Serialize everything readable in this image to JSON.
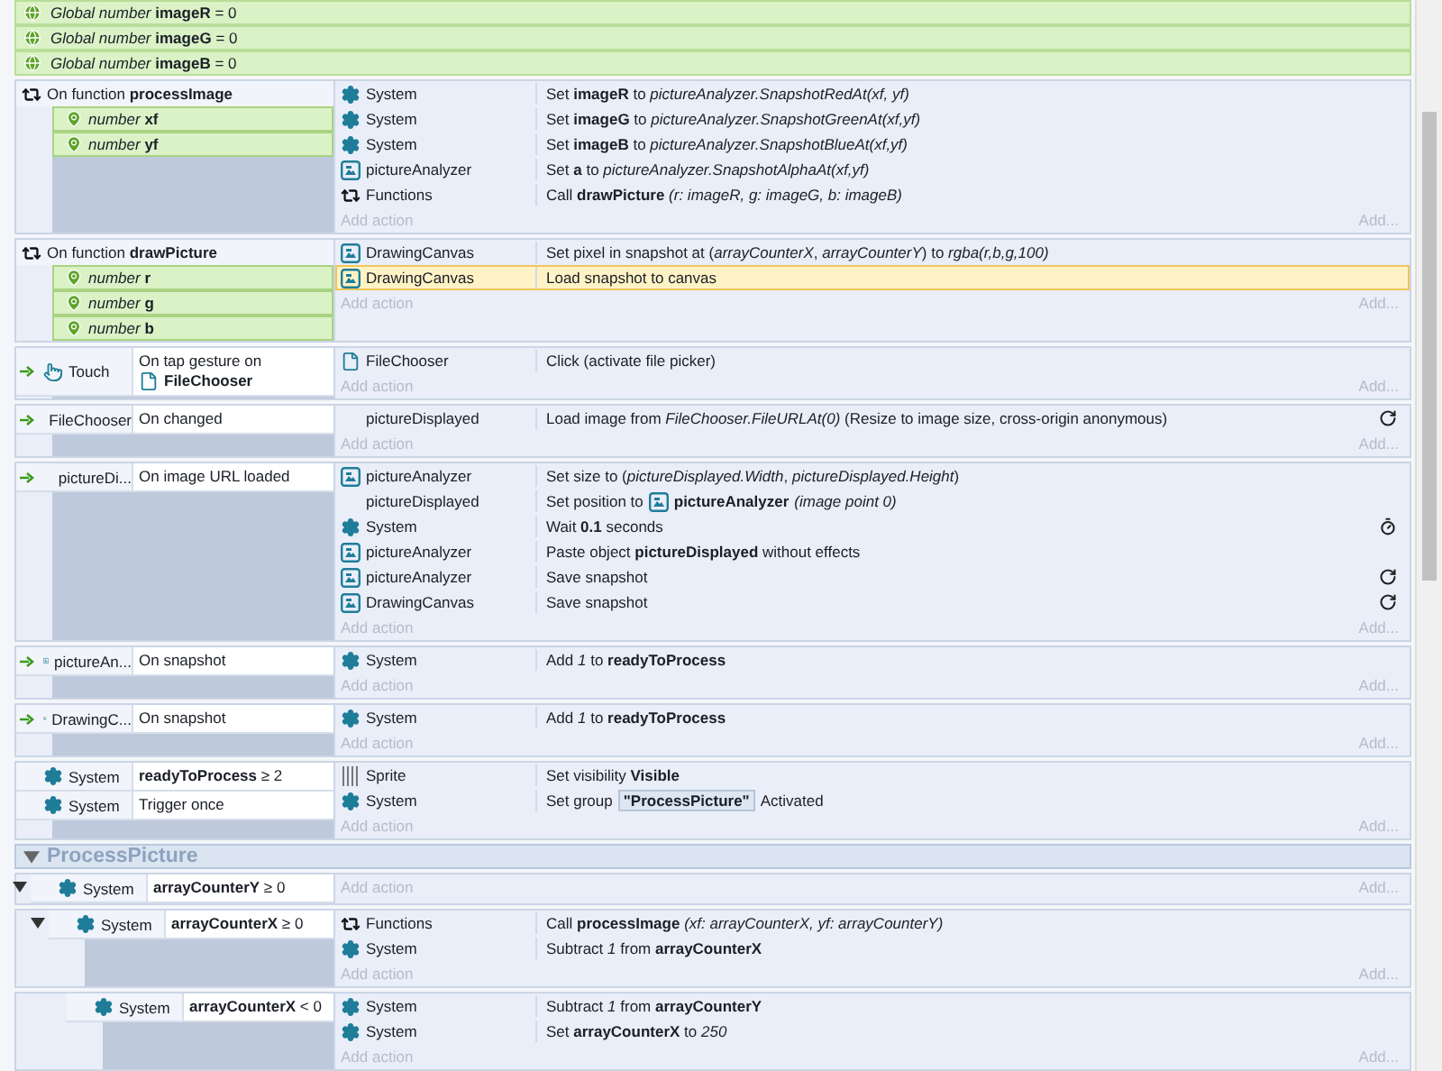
{
  "globals": [
    {
      "text": "*Global number* **imageR** = 0"
    },
    {
      "text": "*Global number* **imageG** = 0"
    },
    {
      "text": "*Global number* **imageB** = 0"
    }
  ],
  "events": [
    {
      "kind": "event",
      "trigger": false,
      "conditions": [
        {
          "kind": "function",
          "text": "On function **processImage**"
        }
      ],
      "params": [
        "*number* **xf**",
        "*number* **yf**"
      ],
      "actions": [
        {
          "kind": "system",
          "object": "System",
          "text": "Set **imageR** to *pictureAnalyzer.SnapshotRedAt(xf, yf)*",
          "selected": false
        },
        {
          "kind": "system",
          "object": "System",
          "text": "Set **imageG** to *pictureAnalyzer.SnapshotGreenAt(xf,yf)*",
          "selected": false
        },
        {
          "kind": "system",
          "object": "System",
          "text": "Set **imageB** to *pictureAnalyzer.SnapshotBlueAt(xf,yf)*",
          "selected": false
        },
        {
          "kind": "canvas",
          "object": "pictureAnalyzer",
          "text": "Set **a** to *pictureAnalyzer.SnapshotAlphaAt(xf,yf)*",
          "selected": false
        },
        {
          "kind": "functions",
          "object": "Functions",
          "text": "Call **drawPicture** *(r: imageR, g: imageG, b: imageB)*",
          "selected": false
        }
      ],
      "add_action": "Add action",
      "add_more": "Add..."
    },
    {
      "kind": "event",
      "trigger": false,
      "conditions": [
        {
          "kind": "function",
          "text": "On function **drawPicture**"
        }
      ],
      "params": [
        "*number* **r**",
        "*number* **g**",
        "*number* **b**"
      ],
      "actions": [
        {
          "kind": "canvas",
          "object": "DrawingCanvas",
          "text": "Set pixel in snapshot at (*arrayCounterX*, *arrayCounterY*) to *rgba(r,b,g,100)*",
          "selected": false
        },
        {
          "kind": "canvas",
          "object": "DrawingCanvas",
          "text": "Load snapshot to canvas",
          "selected": true
        }
      ],
      "add_action": "Add action",
      "add_more": "Add..."
    },
    {
      "kind": "event",
      "trigger": true,
      "conditions": [
        {
          "kind": "touch",
          "object": "Touch",
          "text": "On tap gesture on",
          "ref": {
            "kind": "file",
            "text": "FileChooser"
          }
        }
      ],
      "actions": [
        {
          "kind": "file",
          "object": "FileChooser",
          "text": "Click (activate file picker)",
          "selected": false
        }
      ],
      "add_action": "Add action",
      "add_more": "Add..."
    },
    {
      "kind": "event",
      "trigger": true,
      "conditions": [
        {
          "kind": "file",
          "object": "FileChooser",
          "text": "On changed"
        }
      ],
      "actions": [
        {
          "kind": "plain",
          "object": "pictureDisplayed",
          "text": "Load image from *FileChooser.FileURLAt(0)* (Resize to image size, cross-origin anonymous)",
          "end_icon": {
            "kind": "async"
          },
          "selected": false
        }
      ],
      "add_action": "Add action",
      "add_more": "Add..."
    },
    {
      "kind": "event",
      "trigger": true,
      "conditions": [
        {
          "kind": "plain",
          "object": "pictureDi...",
          "text": "On image URL loaded"
        }
      ],
      "actions": [
        {
          "kind": "canvas",
          "object": "pictureAnalyzer",
          "text": "Set size to (*pictureDisplayed.Width*, *pictureDisplayed.Height*)",
          "selected": false
        },
        {
          "kind": "plain",
          "object": "pictureDisplayed",
          "text": "Set position to",
          "ref": {
            "kind": "canvas",
            "text": "pictureAnalyzer"
          },
          "tail": "*(image point 0)*",
          "selected": false
        },
        {
          "kind": "system",
          "object": "System",
          "text": "Wait **0.1** seconds",
          "end_icon": {
            "kind": "wait"
          },
          "selected": false
        },
        {
          "kind": "canvas",
          "object": "pictureAnalyzer",
          "text": "Paste object **pictureDisplayed** without effects",
          "selected": false
        },
        {
          "kind": "canvas",
          "object": "pictureAnalyzer",
          "text": "Save snapshot",
          "end_icon": {
            "kind": "async"
          },
          "selected": false
        },
        {
          "kind": "canvas",
          "object": "DrawingCanvas",
          "text": "Save snapshot",
          "end_icon": {
            "kind": "async"
          },
          "selected": false
        }
      ],
      "add_action": "Add action",
      "add_more": "Add..."
    },
    {
      "kind": "event",
      "trigger": true,
      "conditions": [
        {
          "kind": "canvas",
          "object": "pictureAn...",
          "text": "On snapshot"
        }
      ],
      "actions": [
        {
          "kind": "system",
          "object": "System",
          "text": "Add *1* to **readyToProcess**",
          "selected": false
        }
      ],
      "add_action": "Add action",
      "add_more": "Add..."
    },
    {
      "kind": "event",
      "trigger": true,
      "conditions": [
        {
          "kind": "canvas",
          "object": "DrawingC...",
          "text": "On snapshot"
        }
      ],
      "actions": [
        {
          "kind": "system",
          "object": "System",
          "text": "Add *1* to **readyToProcess**",
          "selected": false
        }
      ],
      "add_action": "Add action",
      "add_more": "Add..."
    },
    {
      "kind": "event",
      "trigger": false,
      "conditions": [
        {
          "kind": "system",
          "object": "System",
          "text": "**readyToProcess** ≥ 2"
        },
        {
          "kind": "system",
          "object": "System",
          "text": "Trigger once"
        }
      ],
      "actions": [
        {
          "kind": "sprite",
          "object": "Sprite",
          "text": "Set visibility **Visible**",
          "selected": false
        },
        {
          "kind": "system",
          "object": "System",
          "text": "Set group",
          "ref": {
            "kind": "chip",
            "text": "\"ProcessPicture\""
          },
          "tail": "Activated",
          "selected": false
        }
      ],
      "add_action": "Add action",
      "add_more": "Add..."
    },
    {
      "kind": "group",
      "title": "ProcessPicture",
      "expanded": true,
      "children": [
        {
          "kind": "event",
          "trigger": false,
          "expanded": true,
          "conditions": [
            {
              "kind": "system",
              "object": "System",
              "text": "**arrayCounterY** ≥ 0"
            }
          ],
          "add_action": "Add action",
          "add_more": "Add...",
          "children": [
            {
              "kind": "event",
              "trigger": false,
              "expanded": true,
              "conditions": [
                {
                  "kind": "system",
                  "object": "System",
                  "text": "**arrayCounterX** ≥ 0"
                }
              ],
              "actions": [
                {
                  "kind": "functions",
                  "object": "Functions",
                  "text": "Call **processImage** *(xf: arrayCounterX, yf: arrayCounterY)*",
                  "selected": false
                },
                {
                  "kind": "system",
                  "object": "System",
                  "text": "Subtract *1* from **arrayCounterX**",
                  "selected": false
                }
              ],
              "add_action": "Add action",
              "add_more": "Add...",
              "children": [
                {
                  "kind": "event",
                  "trigger": false,
                  "conditions": [
                    {
                      "kind": "system",
                      "object": "System",
                      "text": "**arrayCounterX** < 0"
                    }
                  ],
                  "actions": [
                    {
                      "kind": "system",
                      "object": "System",
                      "text": "Subtract *1* from **arrayCounterY**",
                      "selected": false
                    },
                    {
                      "kind": "system",
                      "object": "System",
                      "text": "Set **arrayCounterX** to *250*",
                      "selected": false
                    }
                  ],
                  "add_action": "Add action",
                  "add_more": "Add..."
                }
              ]
            }
          ]
        }
      ]
    }
  ]
}
